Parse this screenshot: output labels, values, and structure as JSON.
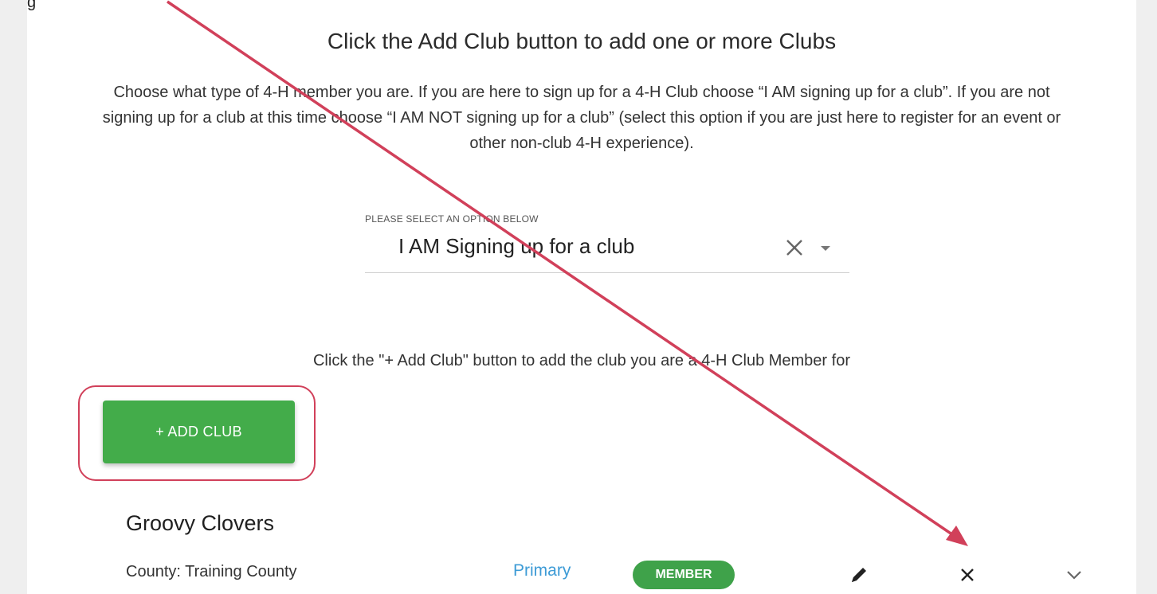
{
  "page": {
    "top_left_label": "g",
    "heading": "Click the Add Club button to add one or more Clubs",
    "instructions": "Choose what type of 4-H member you are. If you are here to sign up for a 4-H Club choose “I AM signing up for a club”. If you are not signing up for a club at this time choose “I AM NOT signing up for a club” (select this option if you are just here to register for an event or other non-club 4-H experience)."
  },
  "select": {
    "label": "PLEASE SELECT AN OPTION BELOW",
    "value": "I AM Signing up for a club",
    "clear_icon": "close-icon",
    "caret_icon": "caret-down-icon"
  },
  "hint": "Click the \"+ Add Club\" button to add the club you are a 4-H Club Member for",
  "add_button": {
    "label": "+ ADD CLUB",
    "color": "#43ac4a"
  },
  "club": {
    "name": "Groovy Clovers",
    "county": "County: Training County",
    "primary_label": "Primary",
    "badge": "MEMBER",
    "actions": [
      "pencil-icon",
      "close-icon",
      "chevron-down-icon"
    ]
  },
  "annotation": {
    "color": "#d1405a"
  }
}
